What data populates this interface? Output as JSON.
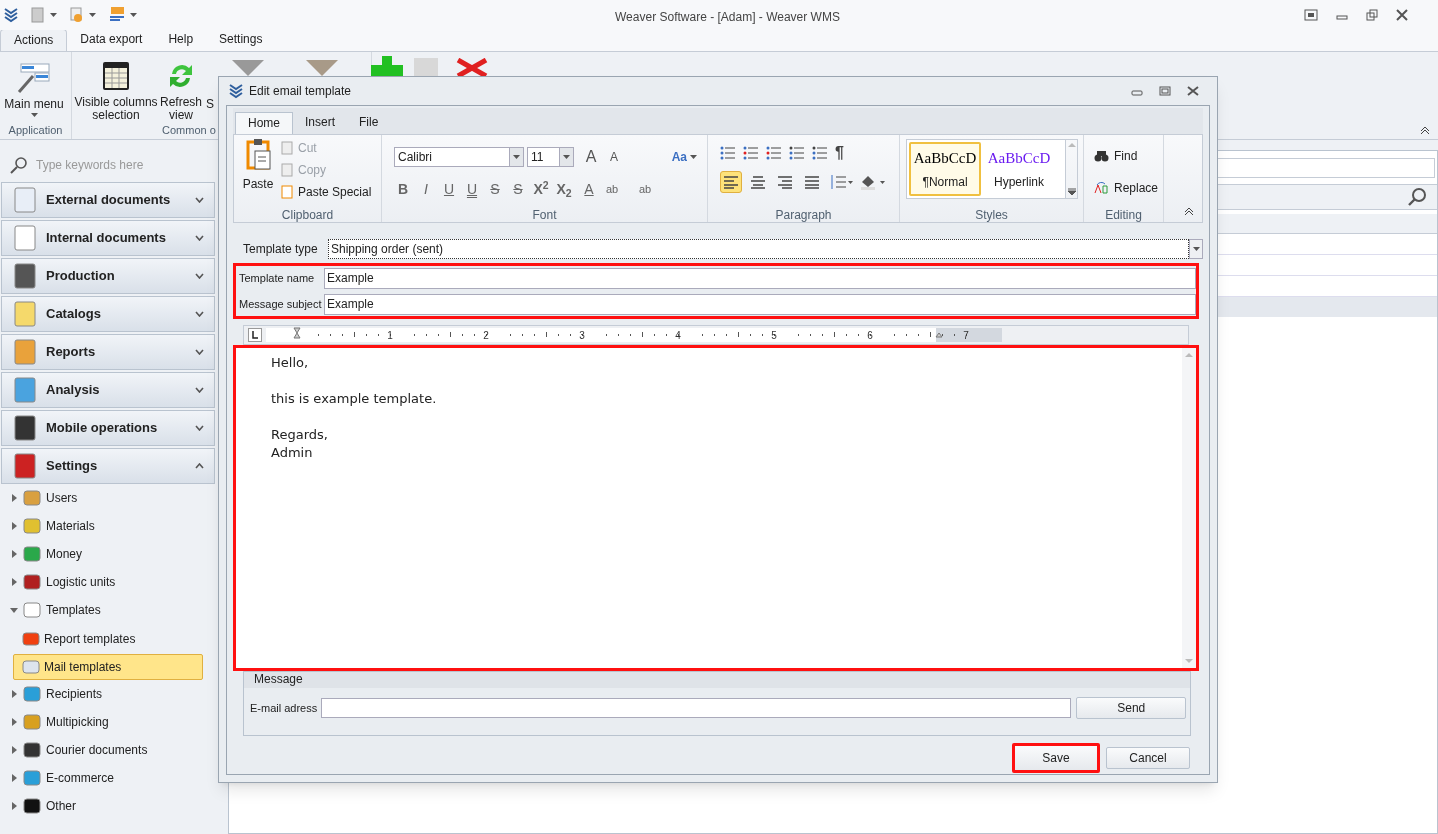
{
  "app": {
    "title": "Weaver Software - [Adam] - Weaver WMS"
  },
  "ribbon": {
    "tabs": [
      {
        "label": "Actions",
        "selected": true
      },
      {
        "label": "Data export",
        "selected": false
      },
      {
        "label": "Help",
        "selected": false
      },
      {
        "label": "Settings",
        "selected": false
      }
    ],
    "groups": [
      {
        "label": "Application",
        "buttons": [
          {
            "label": "Main menu",
            "dropdown": true
          }
        ]
      },
      {
        "label": "Common o",
        "buttons": [
          {
            "label": "Visible columns selection"
          },
          {
            "label": "Refresh view"
          },
          {
            "label": "S"
          }
        ]
      }
    ]
  },
  "sidebar": {
    "search": {
      "placeholder": "Type keywords here"
    },
    "groups": [
      {
        "label": "External documents",
        "expanded": false
      },
      {
        "label": "Internal documents",
        "expanded": false
      },
      {
        "label": "Production",
        "expanded": false
      },
      {
        "label": "Catalogs",
        "expanded": false
      },
      {
        "label": "Reports",
        "expanded": false
      },
      {
        "label": "Analysis",
        "expanded": false
      },
      {
        "label": "Mobile operations",
        "expanded": false
      },
      {
        "label": "Settings",
        "expanded": true
      }
    ],
    "tree": [
      {
        "label": "Users",
        "expanded": false
      },
      {
        "label": "Materials",
        "expanded": false
      },
      {
        "label": "Money",
        "expanded": false
      },
      {
        "label": "Logistic units",
        "expanded": false
      },
      {
        "label": "Templates",
        "expanded": true,
        "children": [
          {
            "label": "Report templates",
            "selected": false
          },
          {
            "label": "Mail templates",
            "selected": true
          }
        ]
      },
      {
        "label": "Recipients",
        "expanded": false
      },
      {
        "label": "Multipicking",
        "expanded": false
      },
      {
        "label": "Courier documents",
        "expanded": false
      },
      {
        "label": "E-commerce",
        "expanded": false
      },
      {
        "label": "Other",
        "expanded": false
      }
    ]
  },
  "dialog": {
    "title": "Edit email template",
    "tabs": [
      {
        "label": "Home",
        "selected": true
      },
      {
        "label": "Insert",
        "selected": false
      },
      {
        "label": "File",
        "selected": false
      }
    ],
    "clipboard": {
      "label": "Clipboard",
      "paste": "Paste",
      "items": [
        {
          "label": "Cut",
          "disabled": true
        },
        {
          "label": "Copy",
          "disabled": true
        },
        {
          "label": "Paste Special",
          "disabled": false
        }
      ]
    },
    "font": {
      "label": "Font",
      "name": "Calibri",
      "size": "11",
      "grow": "A",
      "shrink": "A",
      "case": "Aa",
      "buttons": [
        "B",
        "I",
        "U",
        "U",
        "S",
        "S",
        "X$^{2}$",
        "X$_{2}$",
        "A",
        "ab",
        "ab"
      ]
    },
    "paragraph": {
      "label": "Paragraph",
      "pilcrow": "¶",
      "align": [
        {
          "selected": true
        },
        {
          "selected": false
        },
        {
          "selected": false
        },
        {
          "selected": false
        }
      ]
    },
    "styles": {
      "label": "Styles",
      "items": [
        {
          "sample": "AaBbCcD",
          "name": "¶Normal",
          "selected": true,
          "color": "#000000"
        },
        {
          "sample": "AaBbCcD",
          "name": "Hyperlink",
          "selected": false,
          "color": "#6a1bf0"
        }
      ]
    },
    "editing": {
      "label": "Editing",
      "items": [
        "Find",
        "Replace"
      ]
    },
    "template_type": {
      "label": "Template type",
      "value": "Shipping order (sent)"
    },
    "details": {
      "highlighted": true,
      "fields": [
        {
          "label": "Template name",
          "value": "Example"
        },
        {
          "label": "Message subject",
          "value": "Example"
        }
      ]
    },
    "editor": {
      "highlighted": true,
      "ruler": [
        "1",
        "2",
        "3",
        "4",
        "5",
        "6",
        "7"
      ],
      "paragraphs": [
        [
          "Hello,"
        ],
        [
          "this is example template."
        ],
        [
          "Regards,",
          "Admin"
        ]
      ]
    },
    "message": {
      "title": "Message",
      "email_label": "E-mail adress",
      "send": "Send"
    },
    "buttons": [
      {
        "label": "Save",
        "highlighted": true
      },
      {
        "label": "Cancel",
        "highlighted": false
      }
    ]
  }
}
